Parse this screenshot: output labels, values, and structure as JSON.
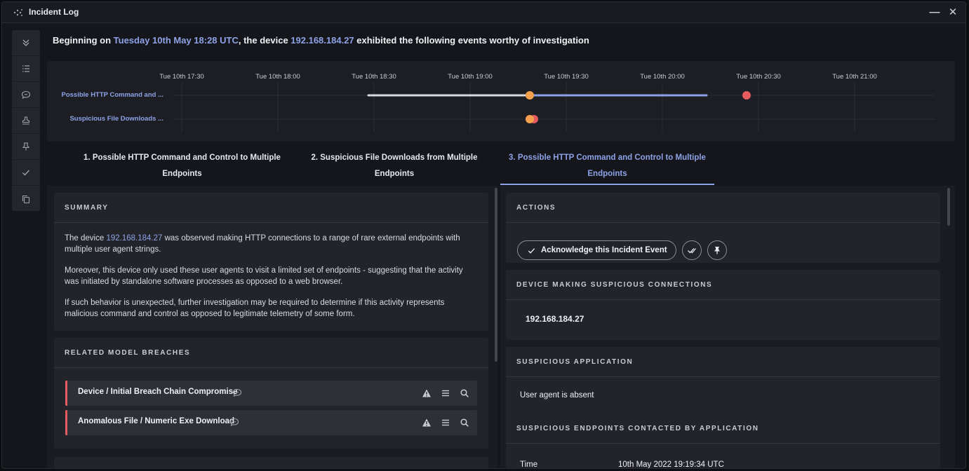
{
  "window": {
    "title": "Incident Log",
    "minimize": "—",
    "close": "✕"
  },
  "sidebar": {
    "items": [
      "chevrons-down-icon",
      "list-icon",
      "chat-icon",
      "stamp-icon",
      "pin-icon",
      "check-icon",
      "copy-icon"
    ]
  },
  "headline": {
    "prefix": "Beginning on ",
    "date": "Tuesday 10th May 18:28 UTC",
    "middle": ", the device ",
    "device": "192.168.184.27",
    "suffix": " exhibited the following events worthy of investigation"
  },
  "timeline": {
    "ticks": [
      "Tue 10th 17:30",
      "Tue 10th 18:00",
      "Tue 10th 18:30",
      "Tue 10th 19:00",
      "Tue 10th 19:30",
      "Tue 10th 20:00",
      "Tue 10th 20:30",
      "Tue 10th 21:00"
    ],
    "rows": [
      "Possible HTTP Command and ...",
      "Suspicious File Downloads ..."
    ]
  },
  "tabs": [
    {
      "line1": "1. Possible HTTP Command and Control to Multiple",
      "line2": "Endpoints"
    },
    {
      "line1": "2. Suspicious File Downloads from Multiple",
      "line2": "Endpoints"
    },
    {
      "line1": "3. Possible HTTP Command and Control to Multiple",
      "line2": "Endpoints"
    }
  ],
  "summary": {
    "header": "SUMMARY",
    "p1_pre": "The device ",
    "p1_ip": "192.168.184.27",
    "p1_post": " was observed making HTTP connections to a range of rare external endpoints with multiple user agent strings.",
    "p2": "Moreover, this device only used these user agents to visit a limited set of endpoints - suggesting that the activity was initiated by standalone software processes as opposed to a web browser.",
    "p3": "If such behavior is unexpected, further investigation may be required to determine if this activity represents malicious command and control as opposed to legitimate telemetry of some form."
  },
  "breaches": {
    "header": "RELATED MODEL BREACHES",
    "items": [
      {
        "label": "Device / Initial Breach Chain Compromise"
      },
      {
        "label": "Anomalous File / Numeric Exe Download"
      }
    ]
  },
  "actions": {
    "header": "ACTIONS",
    "acknowledge": "Acknowledge this Incident Event"
  },
  "device_card": {
    "header": "DEVICE MAKING SUSPICIOUS CONNECTIONS",
    "value": "192.168.184.27"
  },
  "app_card": {
    "header": "SUSPICIOUS APPLICATION",
    "value": "User agent is absent",
    "endpoints_header": "SUSPICIOUS ENDPOINTS CONTACTED BY APPLICATION",
    "time_label": "Time",
    "time_value": "10th May 2022 19:19:34 UTC"
  },
  "colors": {
    "accent": "#8da2e6",
    "orange": "#f4a04e",
    "red": "#e45a5f",
    "breach_bar": "#e45a5f"
  }
}
